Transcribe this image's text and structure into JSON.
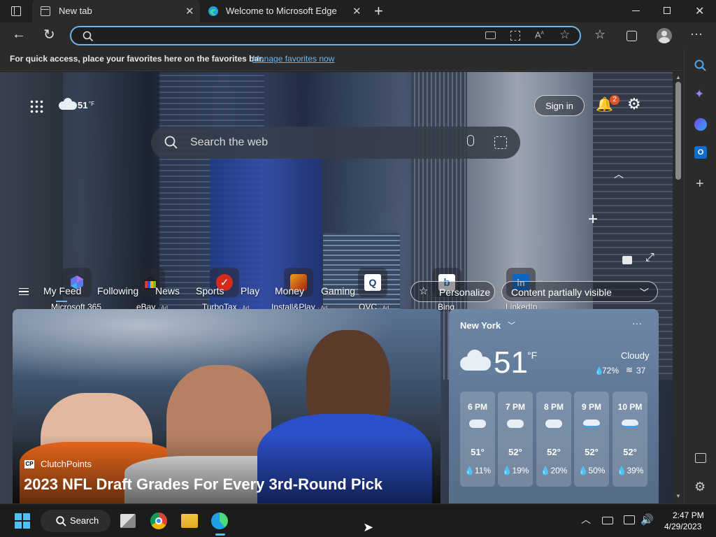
{
  "browser": {
    "tabs": [
      {
        "label": "New tab",
        "active": true
      },
      {
        "label": "Welcome to Microsoft Edge",
        "active": false
      }
    ],
    "address": {
      "value": "",
      "placeholder": ""
    },
    "favorites_hint": "For quick access, place your favorites here on the favorites bar.",
    "favorites_link": "Manage favorites now"
  },
  "newtab": {
    "weather_small": "51",
    "weather_small_unit": "°F",
    "sign_in": "Sign in",
    "notifications_count": "2",
    "search_placeholder": "Search the web",
    "quick_links": [
      {
        "label": "Microsoft 365",
        "ad": ""
      },
      {
        "label": "eBay",
        "ad": "· Ad"
      },
      {
        "label": "TurboTax",
        "ad": "· Ad"
      },
      {
        "label": "Install&Play",
        "ad": "· Ad"
      },
      {
        "label": "QVC",
        "ad": "· Ad"
      },
      {
        "label": "Bing",
        "ad": ""
      },
      {
        "label": "LinkedIn",
        "ad": ""
      }
    ],
    "feed_tabs": [
      "My Feed",
      "Following",
      "News",
      "Sports",
      "Play",
      "Money",
      "Gaming"
    ],
    "more": "···",
    "personalize": "Personalize",
    "content_visibility": "Content partially visible"
  },
  "article": {
    "source": "ClutchPoints",
    "headline": "2023 NFL Draft Grades For Every 3rd-Round Pick"
  },
  "weather": {
    "location": "New York",
    "temp": "51",
    "unit": "°F",
    "condition": "Cloudy",
    "humidity": "72%",
    "wind": "37",
    "hourly": [
      {
        "time": "6 PM",
        "temp": "51°",
        "precip": "11%",
        "icon": "cloud-icon"
      },
      {
        "time": "7 PM",
        "temp": "52°",
        "precip": "19%",
        "icon": "cloud-icon"
      },
      {
        "time": "8 PM",
        "temp": "52°",
        "precip": "20%",
        "icon": "cloud-icon"
      },
      {
        "time": "9 PM",
        "temp": "52°",
        "precip": "50%",
        "icon": "rain-cloud-icon"
      },
      {
        "time": "10 PM",
        "temp": "52°",
        "precip": "39%",
        "icon": "rain-cloud-icon"
      }
    ]
  },
  "taskbar": {
    "search": "Search",
    "time": "2:47 PM",
    "date": "4/29/2023"
  },
  "colors": {
    "accent": "#6cb4ea",
    "badge": "#e0532b",
    "weather_card": "#5d7593"
  }
}
